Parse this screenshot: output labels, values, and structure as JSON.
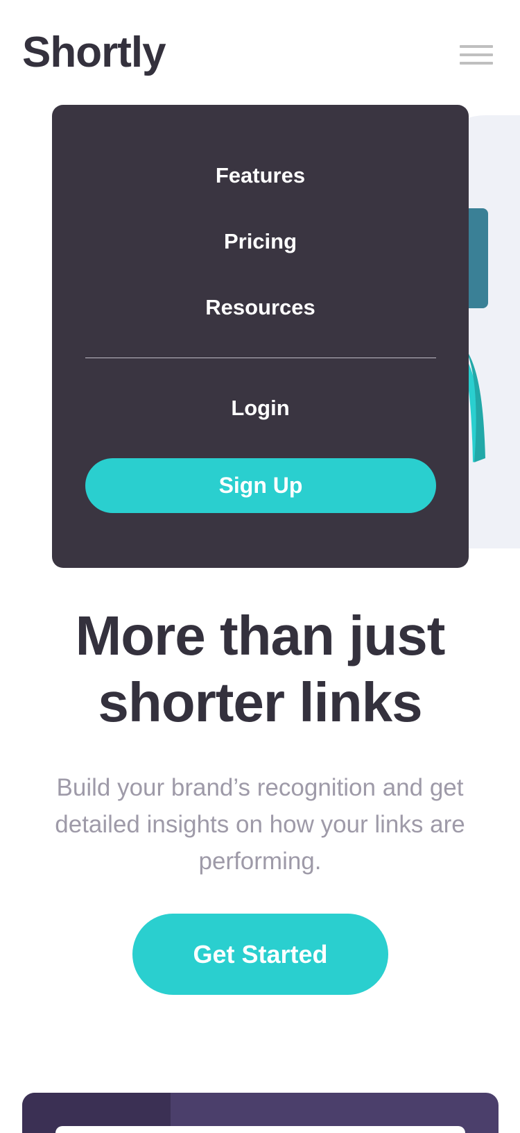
{
  "header": {
    "logo": "Shortly",
    "menu_icon": "hamburger-icon"
  },
  "nav": {
    "items": [
      {
        "label": "Features"
      },
      {
        "label": "Pricing"
      },
      {
        "label": "Resources"
      }
    ],
    "login_label": "Login",
    "signup_label": "Sign Up"
  },
  "hero": {
    "title_line1": "More than just",
    "title_line2": "shorter links",
    "subtitle": "Build your brand’s recognition and get detailed insights on how your links are performing.",
    "cta_label": "Get Started"
  },
  "shorten": {
    "input_placeholder": ""
  },
  "colors": {
    "brand_cyan": "#2acfcf",
    "dark_violet": "#3a3541",
    "heading": "#34313d",
    "muted_text": "#9e9aa8",
    "shorten_bg": "#4b3f6b"
  }
}
